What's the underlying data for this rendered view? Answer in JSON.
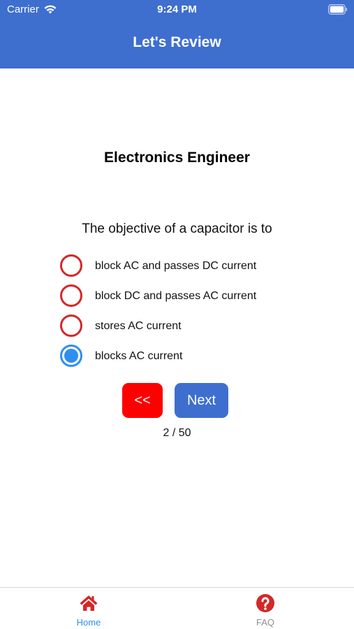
{
  "status_bar": {
    "carrier": "Carrier",
    "time": "9:24 PM"
  },
  "header": {
    "title": "Let's Review",
    "background_color": "#3e6fcf"
  },
  "quiz": {
    "title": "Electronics Engineer",
    "question": "The objective of a capacitor is to",
    "options": [
      {
        "label": "block AC and passes DC current",
        "selected": false
      },
      {
        "label": "block DC and passes AC current",
        "selected": false
      },
      {
        "label": "stores AC current",
        "selected": false
      },
      {
        "label": "blocks AC current",
        "selected": true
      }
    ],
    "prev_label": "<<",
    "next_label": "Next",
    "progress_text": "2 / 50",
    "radio_unselected_color": "#d32828",
    "radio_selected_color": "#2f8ef0",
    "prev_color": "#ff0000"
  },
  "tab_bar": {
    "tabs": [
      {
        "label": "Home",
        "icon": "home-icon",
        "active": true,
        "color": "#d32828"
      },
      {
        "label": "FAQ",
        "icon": "question-icon",
        "active": false,
        "color": "#d32828"
      }
    ],
    "active_label_color": "#2f8ef0",
    "inactive_label_color": "#8e8e93"
  }
}
